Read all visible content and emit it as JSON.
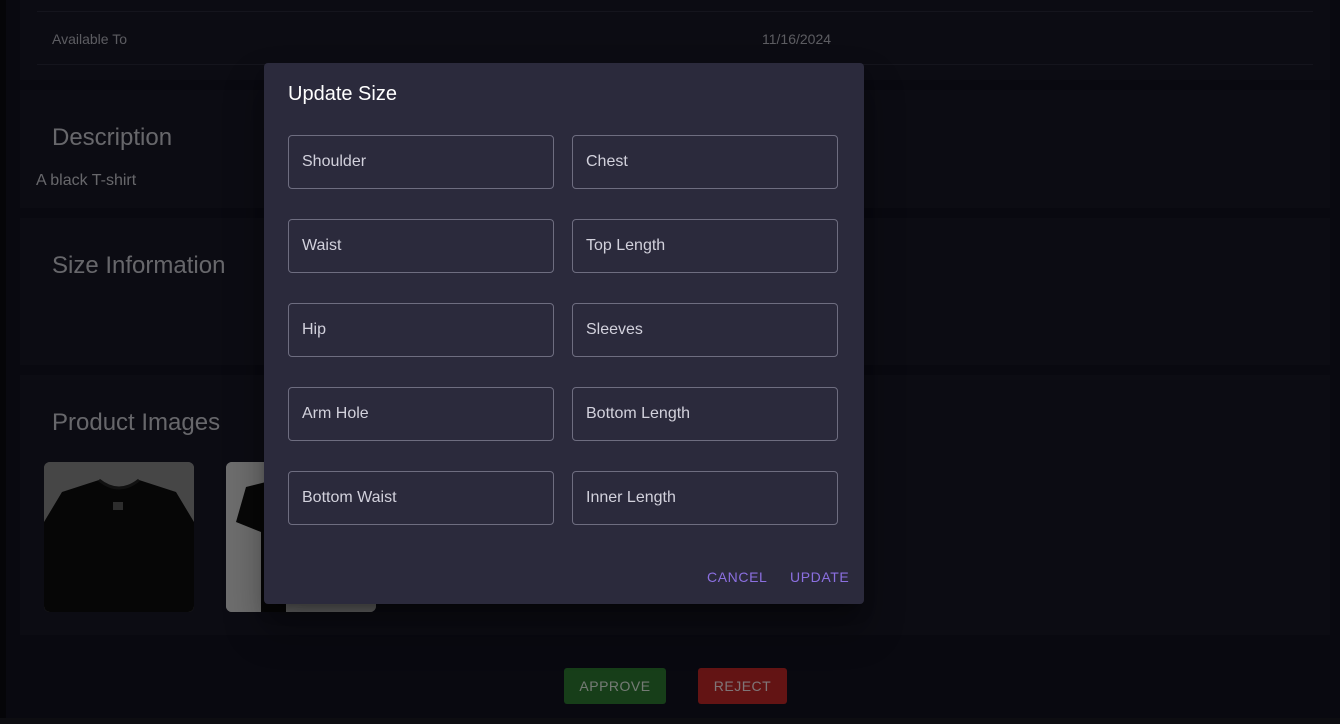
{
  "details": {
    "available_to_label": "Available To",
    "available_to_value": "11/16/2024"
  },
  "description": {
    "title": "Description",
    "text": "A black T-shirt"
  },
  "size_information": {
    "title": "Size Information"
  },
  "product_images": {
    "title": "Product Images"
  },
  "actions": {
    "approve_label": "APPROVE",
    "reject_label": "REJECT"
  },
  "dialog": {
    "title": "Update Size",
    "fields": [
      {
        "placeholder": "Shoulder"
      },
      {
        "placeholder": "Chest"
      },
      {
        "placeholder": "Waist"
      },
      {
        "placeholder": "Top Length"
      },
      {
        "placeholder": "Hip"
      },
      {
        "placeholder": "Sleeves"
      },
      {
        "placeholder": "Arm Hole"
      },
      {
        "placeholder": "Bottom Length"
      },
      {
        "placeholder": "Bottom Waist"
      },
      {
        "placeholder": "Inner Length"
      }
    ],
    "cancel_label": "CANCEL",
    "update_label": "UPDATE"
  },
  "colors": {
    "accent": "#8b6fe0",
    "approve": "#2e7d32",
    "reject": "#c62828",
    "dialog_bg": "#2b2a3c"
  }
}
